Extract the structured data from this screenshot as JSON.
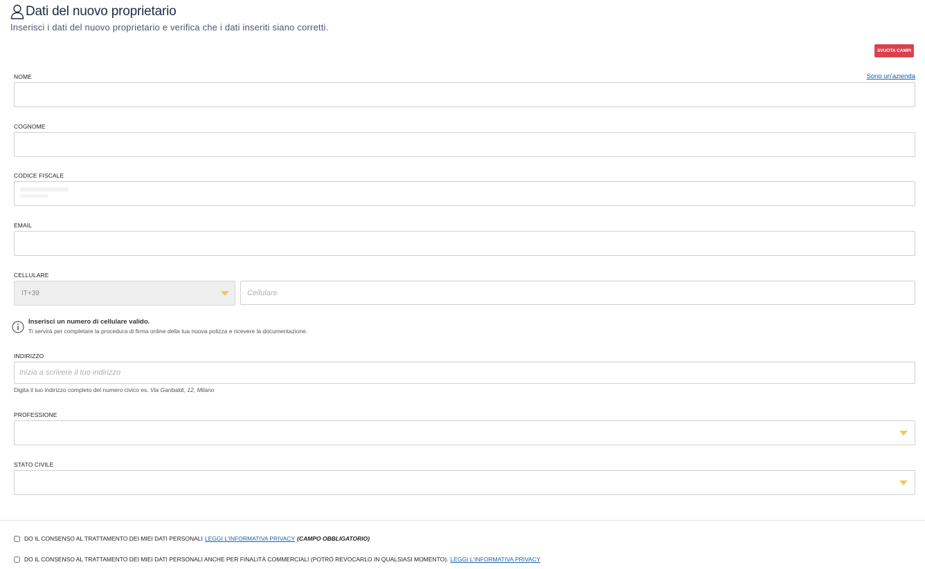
{
  "header": {
    "title": "Dati del nuovo proprietario",
    "subtitle": "Inserisci i dati del nuovo proprietario e verifica che i dati inseriti siano corretti."
  },
  "actions": {
    "clear_label": "SVUOTA CAMPI",
    "company_link": "Sono un'azienda"
  },
  "fields": {
    "nome": {
      "label": "NOME",
      "value": ""
    },
    "cognome": {
      "label": "COGNOME",
      "value": ""
    },
    "codice_fiscale": {
      "label": "CODICE FISCALE",
      "value": ""
    },
    "email": {
      "label": "EMAIL",
      "value": ""
    },
    "cellulare": {
      "label": "CELLULARE",
      "prefix": "IT+39",
      "placeholder": "Cellulare"
    },
    "indirizzo": {
      "label": "INDIRIZZO",
      "placeholder": "Inizia a scrivere il tuo indirizzo",
      "hint": "Digita il tuo indirizzo completo del numero civico es.",
      "hint_example": "Via Garibaldi, 12, Milano"
    },
    "professione": {
      "label": "PROFESSIONE",
      "value": ""
    },
    "stato_civile": {
      "label": "STATO CIVILE",
      "value": ""
    }
  },
  "info": {
    "title": "Inserisci un numero di cellulare valido.",
    "text": "Ti servirà per completare la procedura di firma online della tua nuova polizza e ricevere la documentazione."
  },
  "consents": [
    {
      "text": "Do il consenso al trattamento dei miei dati personali",
      "link": "Leggi l'informativa privacy",
      "suffix": "(campo obbligatorio)"
    },
    {
      "text": "Do il consenso al trattamento dei miei dati personali anche per finalità commerciali (potrò revocarlo in qualsiasi momento).",
      "link": "Leggi l'informativa privacy"
    }
  ],
  "colors": {
    "accent_red": "#d9414f",
    "link": "#1a5fa8",
    "dropdown_arrow": "#f3c94b",
    "title": "#1f2a44"
  }
}
